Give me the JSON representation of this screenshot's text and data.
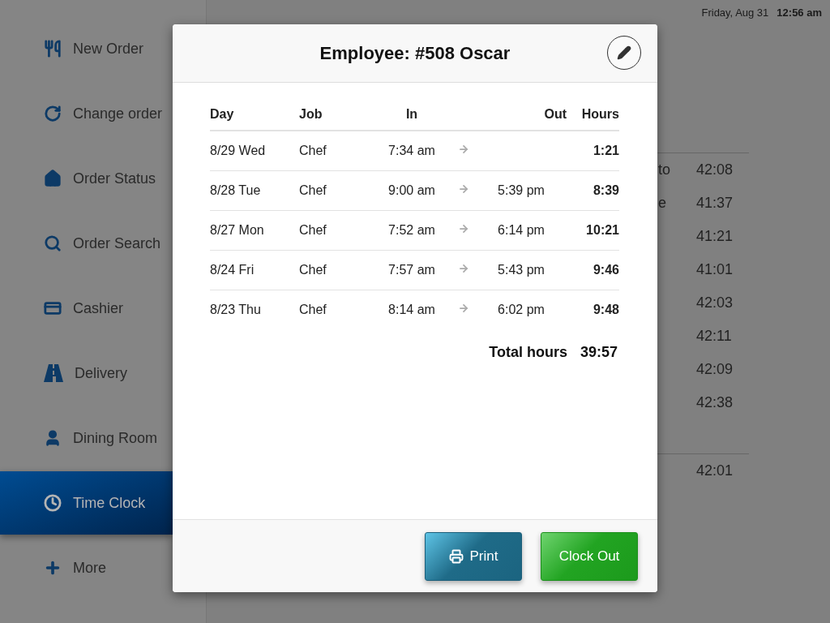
{
  "sidebar": {
    "items": [
      {
        "label": "New Order",
        "selected": false
      },
      {
        "label": "Change order",
        "selected": false
      },
      {
        "label": "Order Status",
        "selected": false
      },
      {
        "label": "Order Search",
        "selected": false
      },
      {
        "label": "Cashier",
        "selected": false
      },
      {
        "label": "Delivery",
        "selected": false
      },
      {
        "label": "Dining Room",
        "selected": false
      },
      {
        "label": "Time Clock",
        "selected": true
      },
      {
        "label": "More",
        "selected": false
      }
    ]
  },
  "header": {
    "date": "Friday, Aug 31",
    "time": "12:56 am"
  },
  "background_table": {
    "rows": [
      {
        "column_1": "to",
        "column_2": "42:08"
      },
      {
        "column_1": "e",
        "column_2": "41:37"
      },
      {
        "column_2": "41:21"
      },
      {
        "column_2": "41:01"
      },
      {
        "column_2": "42:03"
      },
      {
        "column_2": "42:11"
      },
      {
        "column_2": "42:09"
      },
      {
        "column_2": "42:38"
      }
    ],
    "total": "42:01"
  },
  "dialog": {
    "title": "Employee: #508 Oscar",
    "columns": [
      "Day",
      "Job",
      "In",
      "Out",
      "Hours"
    ],
    "rows": [
      {
        "day": "8/29 Wed",
        "job": "Chef",
        "in": "7:34 am",
        "hours": "1:21"
      },
      {
        "day": "8/28 Tue",
        "job": "Chef",
        "in": "9:00 am",
        "out": "5:39 pm",
        "hours": "8:39"
      },
      {
        "day": "8/27 Mon",
        "job": "Chef",
        "in": "7:52 am",
        "out": "6:14 pm",
        "hours": "10:21"
      },
      {
        "day": "8/24 Fri",
        "job": "Chef",
        "in": "7:57 am",
        "out": "5:43 pm",
        "hours": "9:46"
      },
      {
        "day": "8/23 Thu",
        "job": "Chef",
        "in": "8:14 am",
        "out": "6:02 pm",
        "hours": "9:48"
      }
    ],
    "total_label": "Total hours",
    "total_value": "39:57",
    "buttons": [
      {
        "label": "Print",
        "kind": "print"
      },
      {
        "label": "Clock Out",
        "kind": "primary"
      }
    ]
  }
}
